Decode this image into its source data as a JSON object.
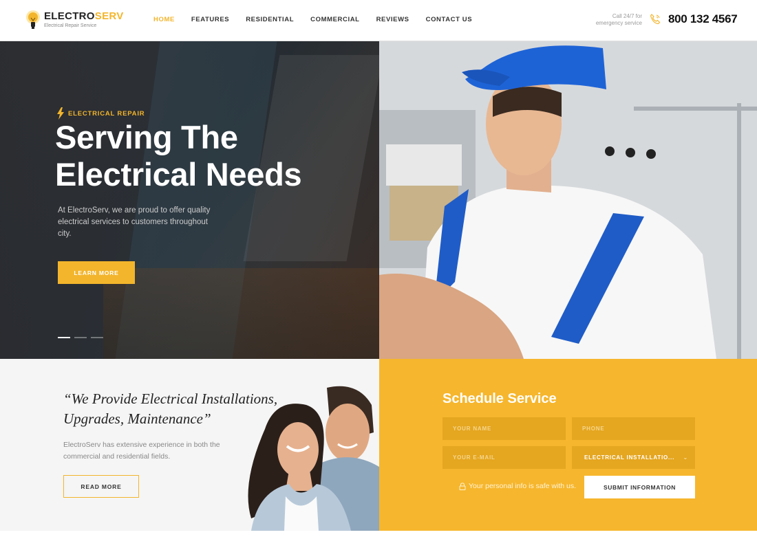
{
  "brand": {
    "name_part1": "ELECTRO",
    "name_part2": "SERV",
    "tagline": "Electrical Repair Service",
    "accent_color": "#f3b52c"
  },
  "nav": {
    "items": [
      {
        "label": "HOME",
        "active": true
      },
      {
        "label": "FEATURES",
        "active": false
      },
      {
        "label": "RESIDENTIAL",
        "active": false
      },
      {
        "label": "COMMERCIAL",
        "active": false
      },
      {
        "label": "REVIEWS",
        "active": false
      },
      {
        "label": "CONTACT US",
        "active": false
      }
    ]
  },
  "contact": {
    "call_line1": "Call 24/7 for",
    "call_line2": "emergency service",
    "phone": "800 132 4567",
    "icon": "phone-icon"
  },
  "hero": {
    "eyebrow": "ELECTRICAL REPAIR",
    "eyebrow_icon": "lightning-bolt-icon",
    "title_line1": "Serving The",
    "title_line2": "Electrical Needs",
    "description": "At ElectroServ, we are proud to offer quality electrical services to customers throughout city.",
    "button": "LEARN MORE",
    "slides_total": 3,
    "slide_active": 1
  },
  "about": {
    "quote_line1": "“We Provide Electrical Installations,",
    "quote_line2": "Upgrades, Maintenance”",
    "description": "ElectroServ has extensive experience in both the commercial and residential fields.",
    "button": "READ MORE"
  },
  "schedule": {
    "title": "Schedule Service",
    "name_placeholder": "YOUR NAME",
    "phone_placeholder": "PHONE",
    "email_placeholder": "YOUR E-MAIL",
    "service_selected": "ELECTRICAL INSTALLATIO...",
    "privacy_note": "Your personal info is safe with us.",
    "submit": "SUBMIT INFORMATION",
    "bg_color": "#f6b62d"
  }
}
